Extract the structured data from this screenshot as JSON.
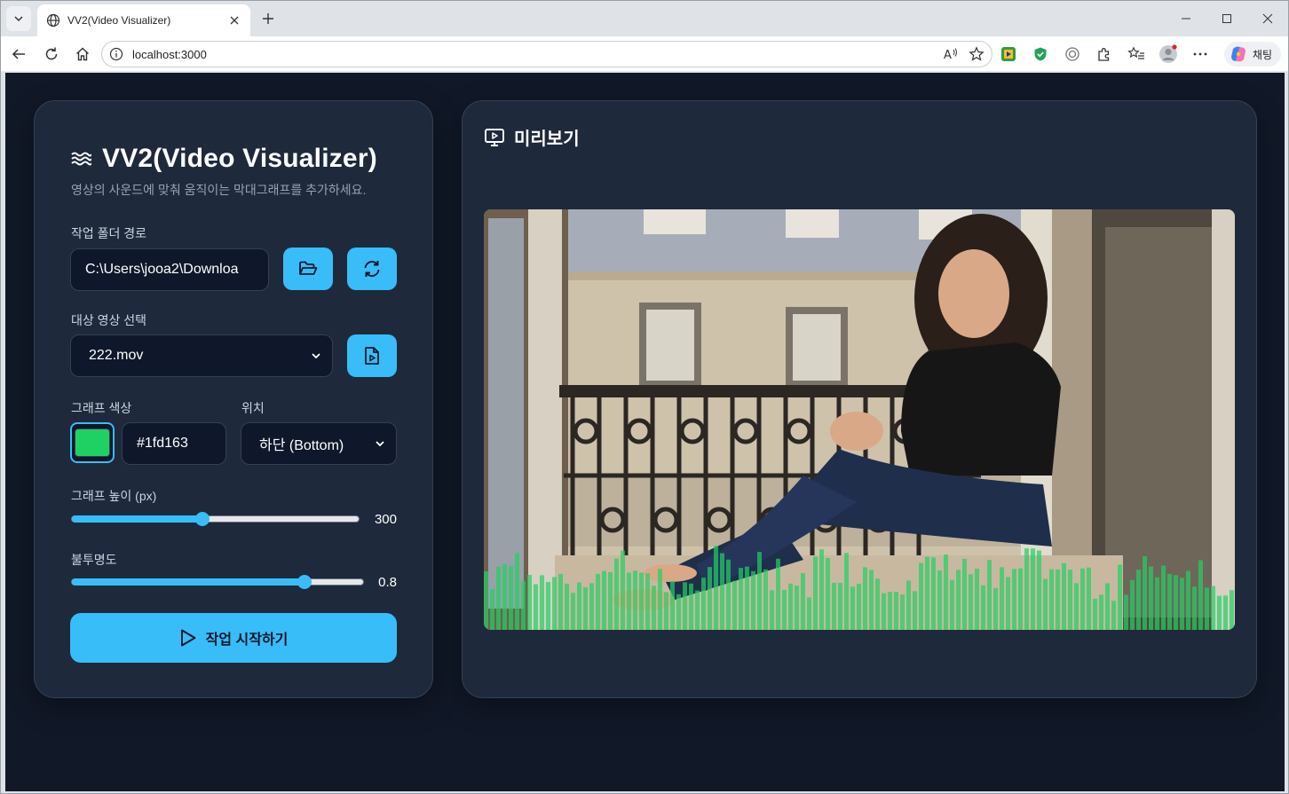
{
  "browser": {
    "tab_title": "VV2(Video Visualizer)",
    "url": "localhost:3000",
    "copilot_label": "채팅"
  },
  "app": {
    "title": "VV2(Video Visualizer)",
    "subtitle": "영상의 사운드에 맞춰 움직이는 막대그래프를 추가하세요.",
    "folder_label": "작업 폴더 경로",
    "folder_value": "C:\\Users\\jooa2\\Downloa",
    "video_label": "대상 영상 선택",
    "video_value": "222.mov",
    "color_label": "그래프 색상",
    "color_value": "#1fd163",
    "position_label": "위치",
    "position_value": "하단 (Bottom)",
    "height_label": "그래프 높이 (px)",
    "height_value": "300",
    "height_fraction": 0.455,
    "opacity_label": "불투명도",
    "opacity_value": "0.8",
    "opacity_fraction": 0.8,
    "start_button": "작업 시작하기"
  },
  "preview": {
    "title": "미리보기"
  },
  "colors": {
    "accent": "#38bdf8",
    "graph": "#1fd163",
    "page_bg": "#111827",
    "panel_bg": "#1e293b"
  }
}
